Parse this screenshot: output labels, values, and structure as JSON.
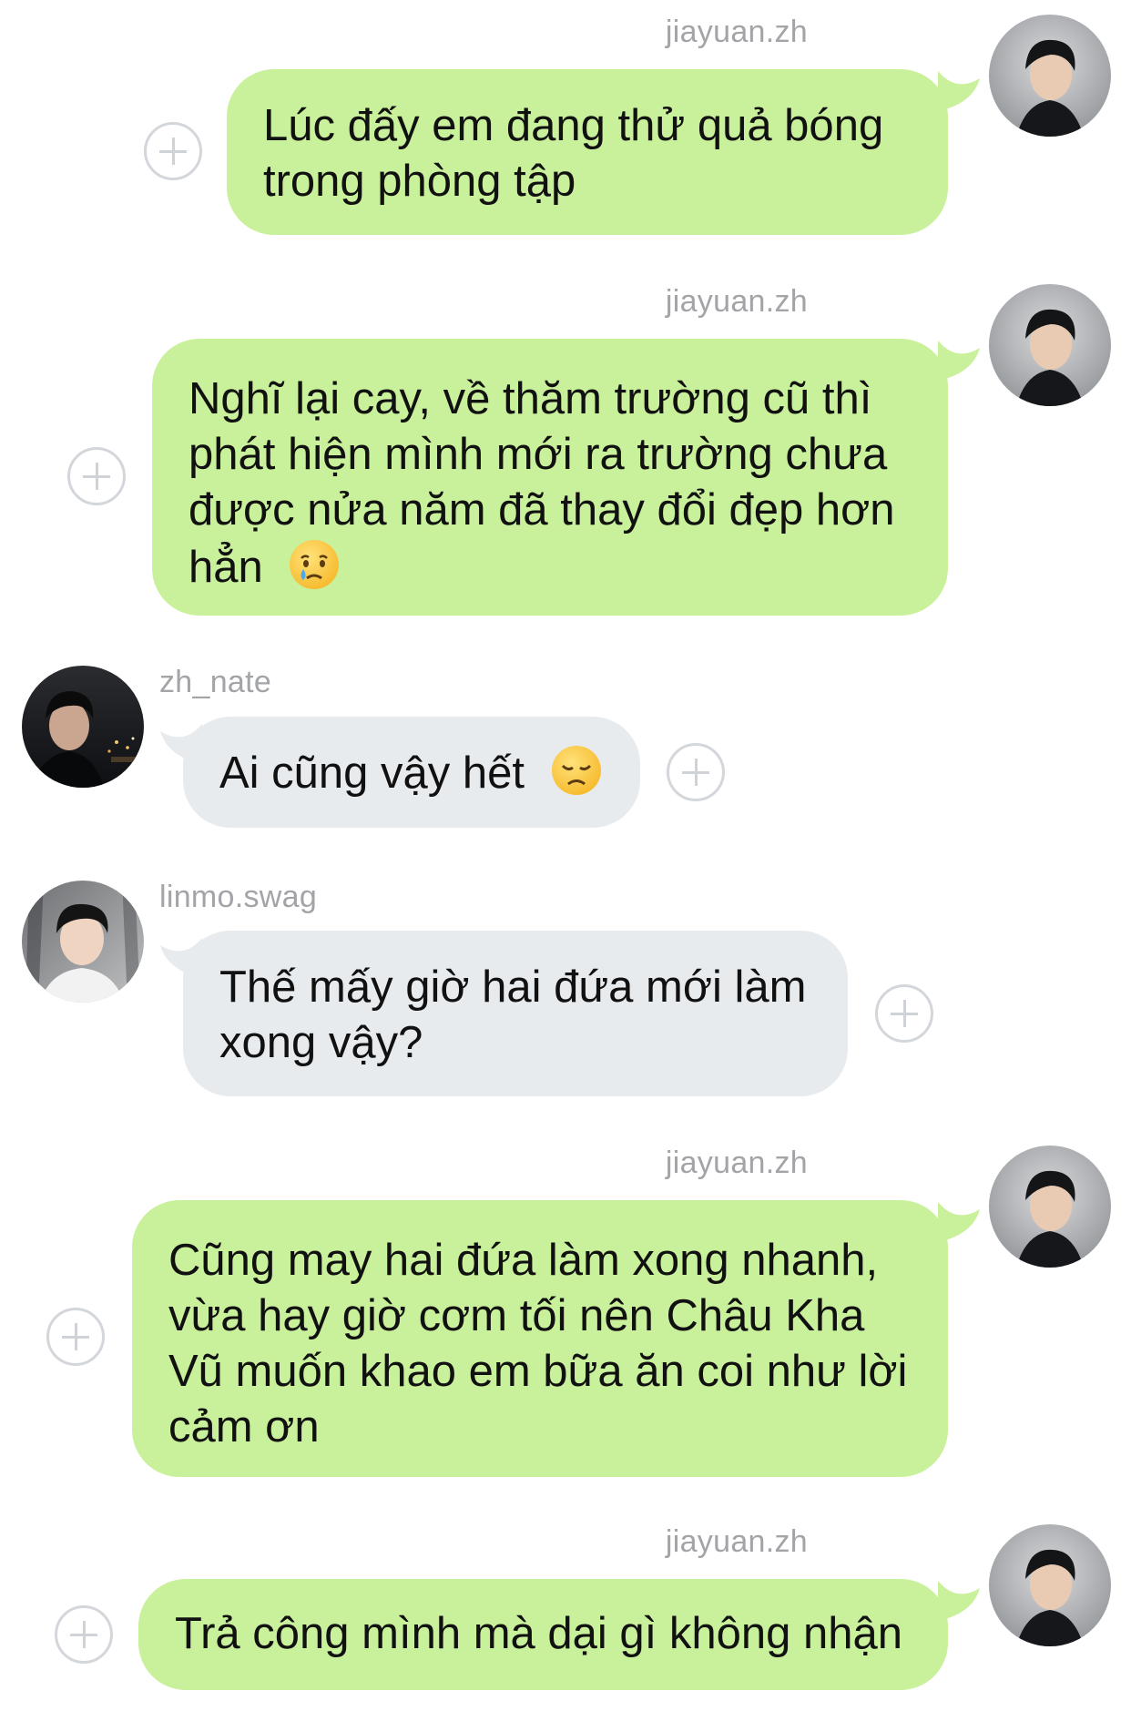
{
  "messages": [
    {
      "user": "jiayuan.zh",
      "text": "Lúc đấy em đang thử quả bóng trong phòng tập",
      "emoji": ""
    },
    {
      "user": "jiayuan.zh",
      "text": "Nghĩ lại cay, về thăm trường cũ thì phát hiện mình mới ra trường chưa được nửa năm đã thay đổi đẹp hơn hẳn",
      "emoji": "crying-face-icon"
    },
    {
      "user": "zh_nate",
      "text": "Ai cũng vậy hết",
      "emoji": "disappointed-face-icon"
    },
    {
      "user": "linmo.swag",
      "text": "Thế mấy giờ hai đứa mới làm xong vậy?",
      "emoji": ""
    },
    {
      "user": "jiayuan.zh",
      "text": "Cũng may hai đứa làm xong nhanh, vừa hay giờ cơm tối nên Châu Kha Vũ muốn khao em bữa ăn coi như lời cảm ơn",
      "emoji": ""
    },
    {
      "user": "jiayuan.zh",
      "text": "Trả công mình mà dại gì không nhận",
      "emoji": ""
    }
  ],
  "colors": {
    "outgoing_bubble": "#c9f09a",
    "incoming_bubble": "#e8ebee",
    "username": "#a2a4a8",
    "reaction_button": "#d3d6da"
  }
}
